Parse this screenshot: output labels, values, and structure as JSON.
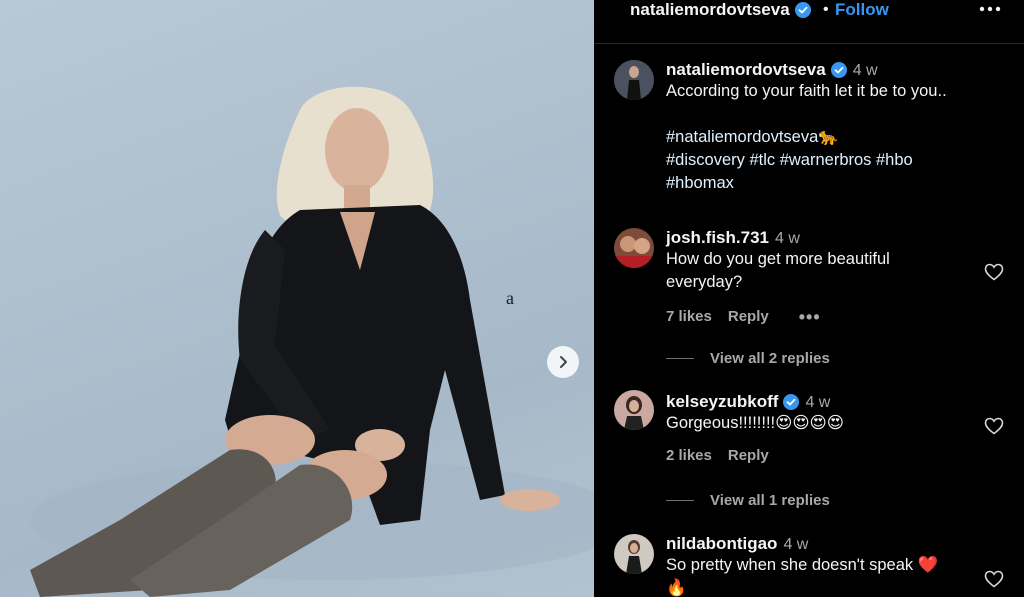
{
  "header": {
    "username": "nataliemordovtseva",
    "separator": "•",
    "follow_label": "Follow"
  },
  "caption": {
    "username": "nataliemordovtseva",
    "time": "4 w",
    "text": "According to your faith let it be to you..",
    "hashtag_line1": "#nataliemordovtseva🐆",
    "hashtag_line2": "#discovery #tlc #warnerbros #hbo",
    "hashtag_line3": "#hbomax"
  },
  "photo": {
    "stray_char": "a"
  },
  "comments": [
    {
      "username": "josh.fish.731",
      "time": "4 w",
      "text_line1": "How do you get more beautiful",
      "text_line2": "everyday?",
      "likes": "7 likes",
      "reply_label": "Reply",
      "more": "•••",
      "view_replies": "View all 2 replies",
      "verified": false
    },
    {
      "username": "kelseyzubkoff",
      "time": "4 w",
      "text_line1": "Gorgeous!!!!!!!!😍😍😍😍",
      "likes": "2 likes",
      "reply_label": "Reply",
      "view_replies": "View all 1 replies",
      "verified": true
    },
    {
      "username": "nildabontigao",
      "time": "4 w",
      "text_line1": "So pretty when she doesn't speak ❤️",
      "text_line2": "🔥",
      "verified": false
    }
  ],
  "colors": {
    "background": "#000000",
    "follow": "#3897f0",
    "muted": "#a8a8a8",
    "verified": "#3897f0"
  }
}
